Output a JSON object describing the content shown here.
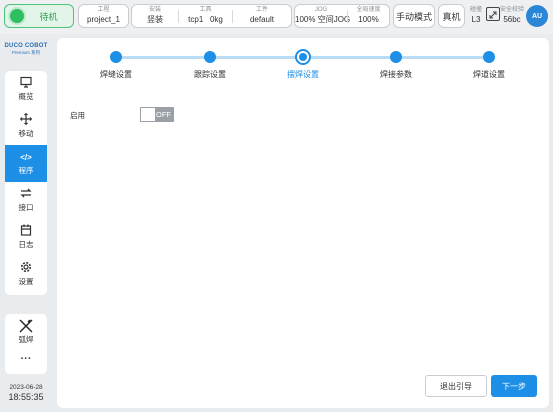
{
  "topbar": {
    "status": "待机",
    "project": {
      "label": "工程",
      "value": "project_1"
    },
    "install": {
      "label": "安装",
      "value": "竖装"
    },
    "tool": {
      "label": "工具",
      "value_name": "tcp1",
      "value_load": "0kg"
    },
    "workpiece": {
      "label": "工件",
      "value": "default"
    },
    "jog": {
      "label": "JOG",
      "value_pct": "100%",
      "value_mode": "空间JOG"
    },
    "global_speed": {
      "label": "全局速度",
      "value": "100%"
    },
    "manual_mode": "手动模式",
    "real_machine": "真机",
    "collision": {
      "label": "碰撞",
      "value": "L3"
    },
    "safety_check": {
      "label": "安全校验",
      "value": "56bc"
    },
    "avatar": "AU"
  },
  "sidebar": {
    "logo_line1": "DUCO COBOT",
    "logo_line2": "Premium 系列",
    "items": [
      {
        "label": "概览",
        "icon": "monitor-icon"
      },
      {
        "label": "移动",
        "icon": "move-icon"
      },
      {
        "label": "程序",
        "icon": "code-icon"
      },
      {
        "label": "接口",
        "icon": "swap-icon"
      },
      {
        "label": "日志",
        "icon": "calendar-icon"
      },
      {
        "label": "设置",
        "icon": "gear-icon"
      }
    ],
    "tool_item": {
      "label": "弧焊",
      "icon": "welding-icon"
    },
    "more": "···",
    "date": "2023-06-28",
    "time": "18:55:35"
  },
  "wizard": {
    "steps": [
      "焊缝设置",
      "跟踪设置",
      "摆焊设置",
      "焊接参数",
      "焊道设置"
    ],
    "active_step": 2,
    "enable_label": "启用",
    "toggle_state": "OFF",
    "exit_button": "退出引导",
    "next_button": "下一步"
  },
  "colors": {
    "accent": "#1e8fe6",
    "status_green": "#2fbf62",
    "toggle_off": "#9aa0a6"
  }
}
